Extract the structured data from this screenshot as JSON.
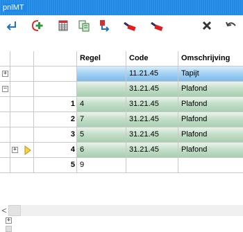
{
  "window": {
    "title": "pnlMT"
  },
  "toolbar": {
    "icons": [
      "return-icon",
      "add-icon",
      "grid-icon",
      "copy-icon",
      "insert-row-icon",
      "remove-red-icon",
      "remove-red-2-icon",
      "delete-x-icon",
      "undo-icon"
    ]
  },
  "table": {
    "columns": [
      "",
      "",
      "",
      "Regel",
      "Code",
      "Omschrijving"
    ],
    "rows": [
      {
        "num": "",
        "regel": "",
        "code": "11.21.45",
        "omschrijving": "Tapijt",
        "style": "blue",
        "expander": "+"
      },
      {
        "num": "",
        "regel": "",
        "code": "31.21.45",
        "omschrijving": "Plafond",
        "style": "green",
        "expander": "−"
      },
      {
        "num": "1",
        "regel": "4",
        "code": "31.21.45",
        "omschrijving": "Plafond",
        "style": "green"
      },
      {
        "num": "2",
        "regel": "7",
        "code": "31.21.45",
        "omschrijving": "Plafond",
        "style": "green"
      },
      {
        "num": "3",
        "regel": "5",
        "code": "31.21.45",
        "omschrijving": "Plafond",
        "style": "green"
      },
      {
        "num": "4",
        "regel": "6",
        "code": "31.21.45",
        "omschrijving": "Plafond",
        "style": "green",
        "subexpander": "+",
        "current": true
      },
      {
        "num": "5",
        "regel": "9",
        "code": "",
        "omschrijving": "",
        "style": "white"
      }
    ]
  },
  "scrollbar": {
    "left_arrow": "<"
  },
  "footer": {
    "expander": "+"
  },
  "colors": {
    "title_bg": "#1e88e5",
    "selected_blue": "#a6d3f4",
    "row_green": "#c4dfc9",
    "grid_line": "#c9c9c9"
  }
}
